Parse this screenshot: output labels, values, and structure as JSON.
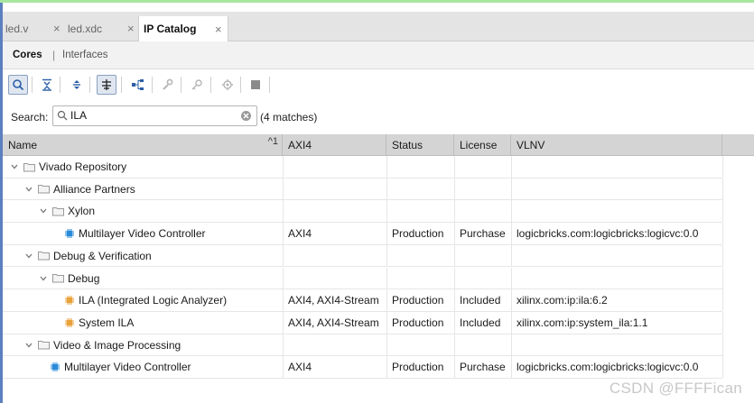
{
  "tabs": [
    {
      "label": "led.v",
      "close": "×"
    },
    {
      "label": "led.xdc",
      "close": "×"
    },
    {
      "label": "IP Catalog",
      "close": "×"
    }
  ],
  "subtabs": {
    "cores": "Cores",
    "sep": "|",
    "interfaces": "Interfaces"
  },
  "toolbar": {
    "icons": [
      "search-icon",
      "collapse-all-icon",
      "expand-all-icon",
      "group-by-icon",
      "hierarchy-icon",
      "customize-ip-icon",
      "license-key-icon",
      "ip-settings-icon",
      "stop-icon"
    ]
  },
  "search": {
    "label": "Search:",
    "value": "ILA",
    "matches": "(4 matches)"
  },
  "table": {
    "columns": [
      "Name",
      "AXI4",
      "Status",
      "License",
      "VLNV"
    ],
    "sort_indicator": "^1",
    "rows": [
      {
        "name": "Vivado Repository",
        "axi4": "",
        "status": "",
        "license": "",
        "vlnv": ""
      },
      {
        "name": "Alliance Partners",
        "axi4": "",
        "status": "",
        "license": "",
        "vlnv": ""
      },
      {
        "name": "Xylon",
        "axi4": "",
        "status": "",
        "license": "",
        "vlnv": ""
      },
      {
        "name": "Multilayer Video Controller",
        "axi4": "AXI4",
        "status": "Production",
        "license": "Purchase",
        "vlnv": "logicbricks.com:logicbricks:logicvc:0.0"
      },
      {
        "name": "Debug & Verification",
        "axi4": "",
        "status": "",
        "license": "",
        "vlnv": ""
      },
      {
        "name": "Debug",
        "axi4": "",
        "status": "",
        "license": "",
        "vlnv": ""
      },
      {
        "name": "ILA (Integrated Logic Analyzer)",
        "axi4": "AXI4, AXI4-Stream",
        "status": "Production",
        "license": "Included",
        "vlnv": "xilinx.com:ip:ila:6.2"
      },
      {
        "name": "System ILA",
        "axi4": "AXI4, AXI4-Stream",
        "status": "Production",
        "license": "Included",
        "vlnv": "xilinx.com:ip:system_ila:1.1"
      },
      {
        "name": "Video & Image Processing",
        "axi4": "",
        "status": "",
        "license": "",
        "vlnv": ""
      },
      {
        "name": "Multilayer Video Controller",
        "axi4": "AXI4",
        "status": "Production",
        "license": "Purchase",
        "vlnv": "logicbricks.com:logicbricks:logicvc:0.0"
      }
    ]
  },
  "watermark": "CSDN @FFFFican",
  "colors": {
    "ip_blue": "#2a8ad8",
    "ip_orange": "#e8a23a",
    "header_bg": "#d4d4d4",
    "selected_tool": "#dfe6f0"
  }
}
